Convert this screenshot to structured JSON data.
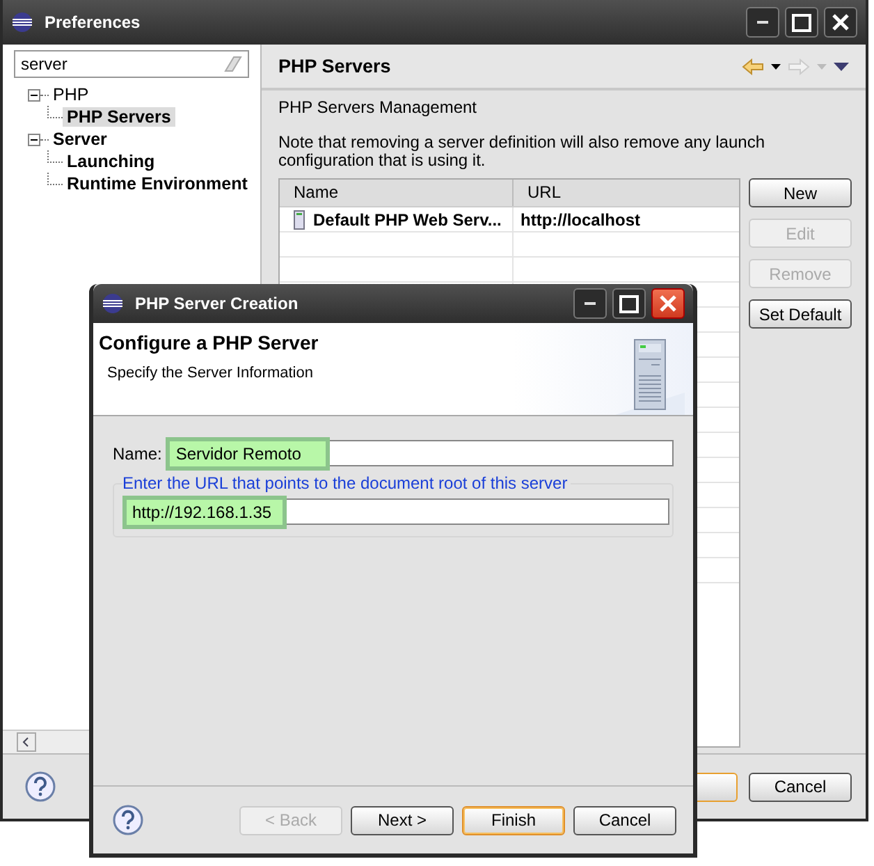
{
  "preferences": {
    "title": "Preferences",
    "filter": {
      "value": "server"
    },
    "tree": [
      {
        "label": "PHP",
        "expanded": true,
        "bold": false,
        "selected": false,
        "children": [
          {
            "label": "PHP Servers",
            "bold": true,
            "selected": true
          }
        ]
      },
      {
        "label": "Server",
        "expanded": true,
        "bold": true,
        "selected": false,
        "children": [
          {
            "label": "Launching",
            "bold": true,
            "selected": false
          },
          {
            "label": "Runtime Environment",
            "bold": true,
            "selected": false
          }
        ]
      }
    ],
    "page_title": "PHP Servers",
    "section": "PHP Servers Management",
    "note": "Note that removing a server definition will also remove any launch configuration that is using it.",
    "table": {
      "columns": [
        "Name",
        "URL"
      ],
      "rows": [
        {
          "cells": [
            "Default PHP Web Serv...",
            "http://localhost"
          ]
        }
      ]
    },
    "side_buttons": [
      {
        "label": "New",
        "disabled": false
      },
      {
        "label": "Edit",
        "disabled": true
      },
      {
        "label": "Remove",
        "disabled": true
      },
      {
        "label": "Set Default",
        "disabled": false
      }
    ],
    "footer_buttons": [
      "Cancel"
    ]
  },
  "dialog": {
    "title": "PHP Server Creation",
    "heading": "Configure a PHP Server",
    "subheading": "Specify the Server Information",
    "name_label": "Name:",
    "name_value": "Servidor Remoto",
    "url_group": "Enter the URL that points to the document root of this server",
    "url_value": "http://192.168.1.35",
    "highlighted": true,
    "buttons": [
      {
        "label": "< Back",
        "disabled": true,
        "default": false
      },
      {
        "label": "Next >",
        "disabled": false,
        "default": false
      },
      {
        "label": "Finish",
        "disabled": false,
        "default": true
      },
      {
        "label": "Cancel",
        "disabled": false,
        "default": false
      }
    ]
  }
}
